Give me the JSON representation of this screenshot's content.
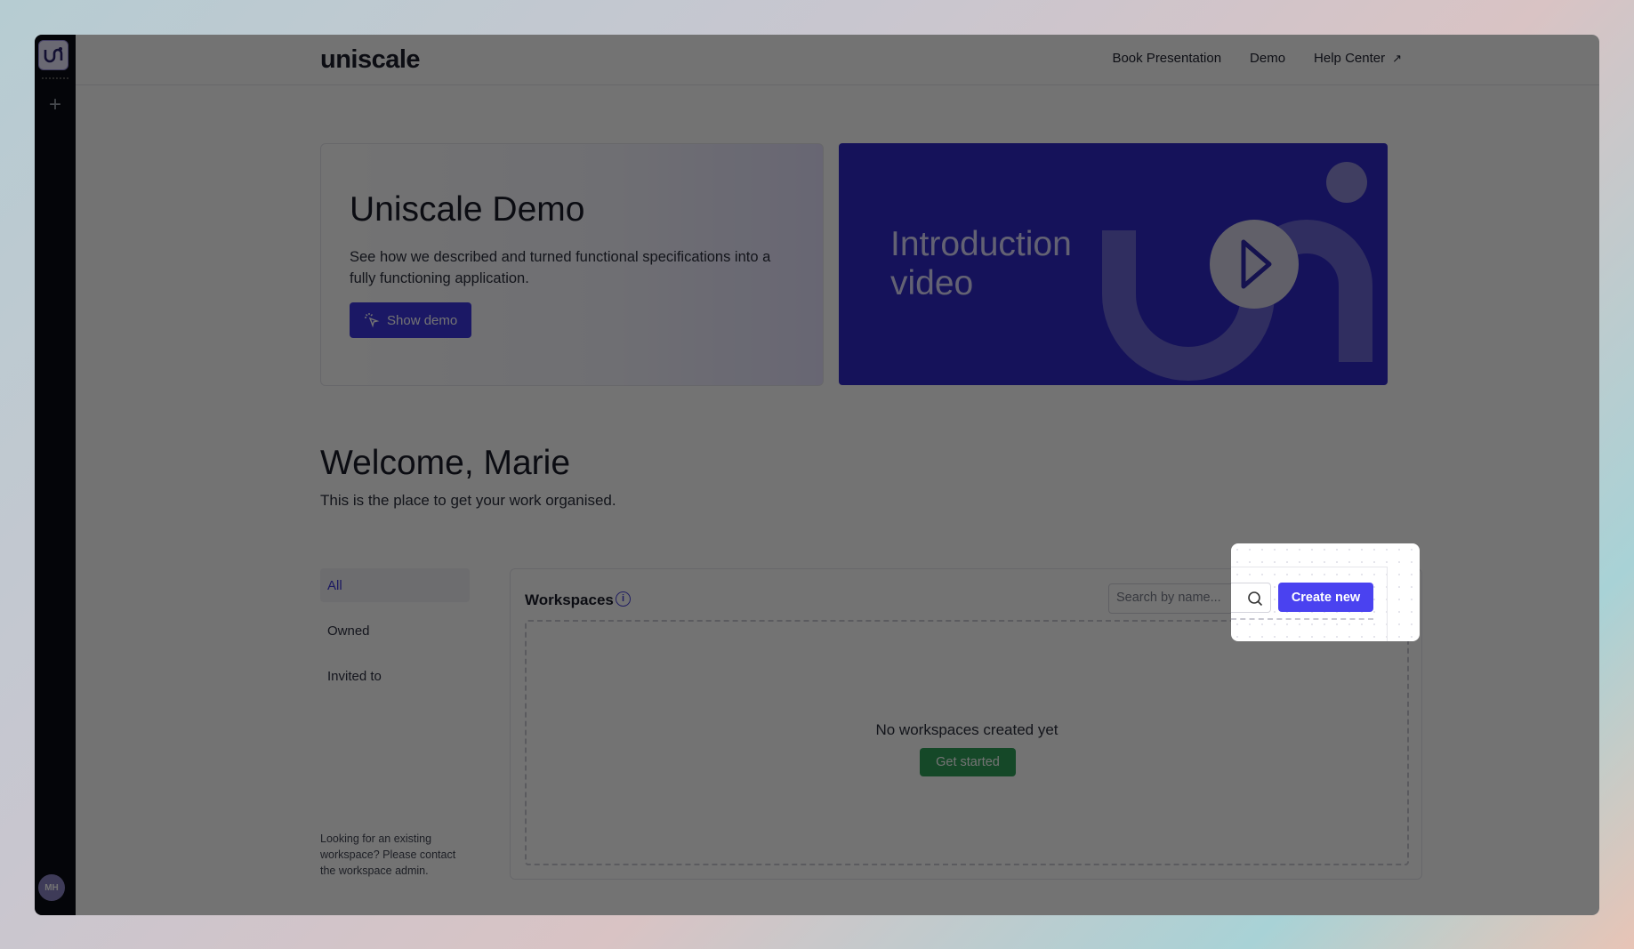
{
  "app": {
    "brand": "uniscale",
    "rail_logo": "uni",
    "avatar_initials": "MH"
  },
  "topnav": {
    "items": [
      "Book Presentation",
      "Demo",
      "Help Center"
    ],
    "external_icon": "arrow-up-right-icon"
  },
  "demo": {
    "title": "Uniscale Demo",
    "description": "See how we described and turned functional specifications into a fully functioning application.",
    "button_label": "Show demo",
    "button_icon": "cursor-click-icon"
  },
  "video": {
    "title": "Introduction video",
    "play_icon": "play-icon"
  },
  "welcome": {
    "title": "Welcome, Marie",
    "subtitle": "This is the place to get your work organised."
  },
  "filters": {
    "items": [
      "All",
      "Owned",
      "Invited to"
    ],
    "active": "All",
    "note": "Looking for an existing workspace? Please contact the workspace admin."
  },
  "workspaces": {
    "title": "Workspaces",
    "search_placeholder": "Search by name...",
    "create_label": "Create new",
    "empty_text": "No workspaces created yet",
    "get_started_label": "Get started"
  },
  "colors": {
    "accent": "#4a42f0",
    "video_bg": "#3029c8",
    "success": "#2fa15a",
    "rail": "#0b0d14"
  }
}
